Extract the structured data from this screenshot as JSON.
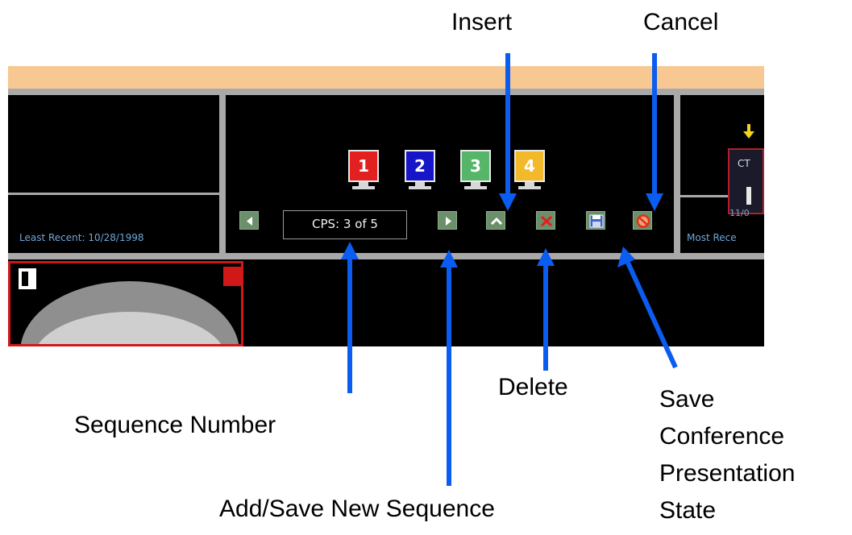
{
  "annotations": {
    "insert": "Insert",
    "cancel": "Cancel",
    "sequence_number": "Sequence Number",
    "add_save": "Add/Save New Sequence",
    "delete": "Delete",
    "save_lines": [
      "Save",
      "Conference",
      "Presentation",
      "State"
    ]
  },
  "timeline": {
    "least_recent": "Least Recent: 10/28/1998",
    "most_recent": "Most Rece",
    "ct_label": "CT",
    "ct_date": "11/0"
  },
  "monitors": [
    {
      "label": "1",
      "color": "#e32020"
    },
    {
      "label": "2",
      "color": "#1616c8"
    },
    {
      "label": "3",
      "color": "#55b66a"
    },
    {
      "label": "4",
      "color": "#f2b92a"
    }
  ],
  "toolbar": {
    "sequence_text": "CPS: 3 of 5"
  },
  "colors": {
    "arrow_blue": "#0b5cf0",
    "tan_bar": "#f7c892",
    "divider_gray": "#a9a9a9",
    "label_blue": "#6fa6d6",
    "button_green": "#6b8f6a",
    "thumb_red": "#d01818"
  },
  "icons": [
    "left-arrow-icon",
    "right-arrow-icon",
    "insert-chevron-icon",
    "delete-x-icon",
    "save-floppy-icon",
    "cancel-no-icon",
    "down-arrow-icon"
  ]
}
